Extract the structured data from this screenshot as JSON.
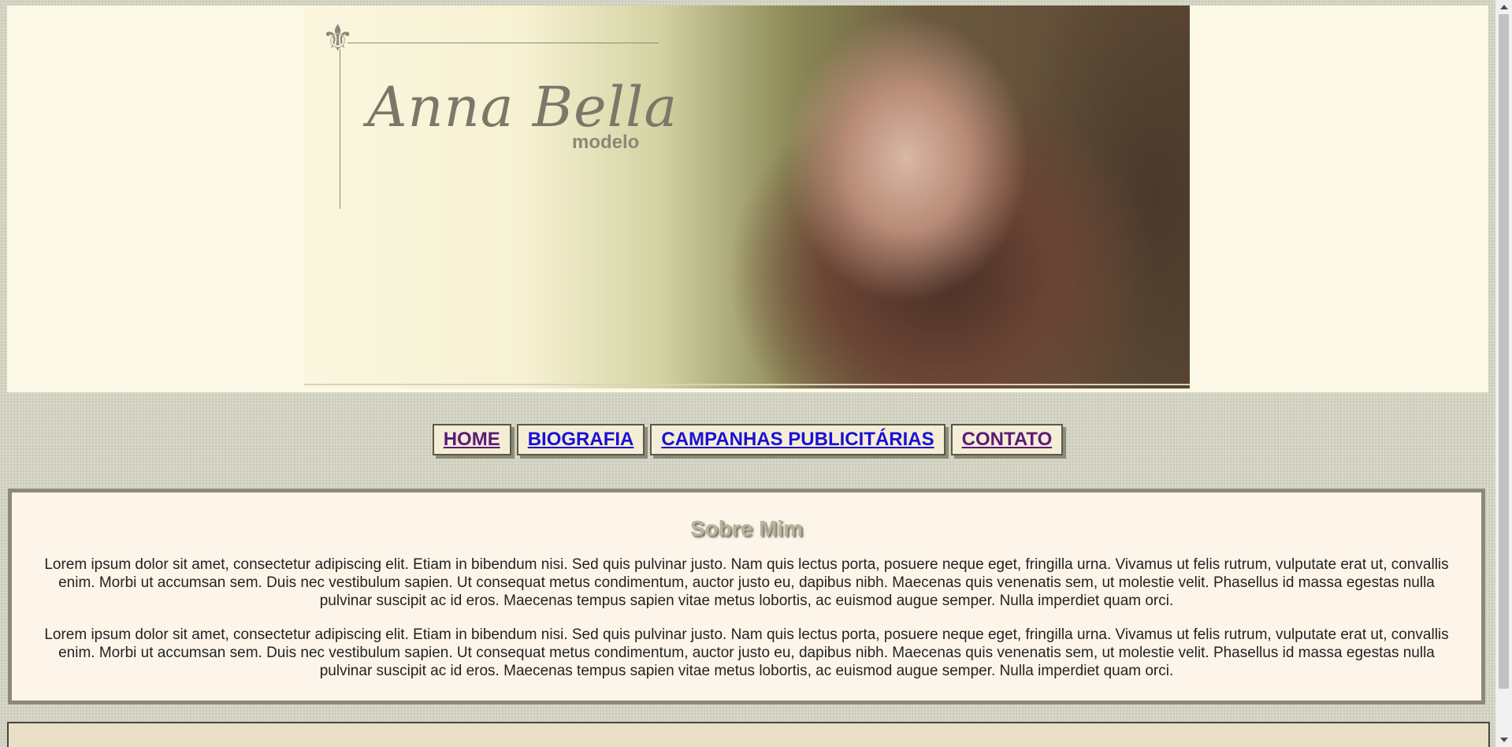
{
  "header": {
    "brand_name": "Anna Bella",
    "brand_subtitle": "modelo",
    "logo_glyph": "⚜"
  },
  "nav": {
    "items": [
      {
        "label": "HOME",
        "visited": true
      },
      {
        "label": "BIOGRAFIA",
        "visited": false
      },
      {
        "label": "CAMPANHAS PUBLICITÁRIAS",
        "visited": false
      },
      {
        "label": "CONTATO",
        "visited": true
      }
    ]
  },
  "content": {
    "title": "Sobre Mim",
    "paragraphs": [
      "Lorem ipsum dolor sit amet, consectetur adipiscing elit. Etiam in bibendum nisi. Sed quis pulvinar justo. Nam quis lectus porta, posuere neque eget, fringilla urna. Vivamus ut felis rutrum, vulputate erat ut, convallis enim. Morbi ut accumsan sem. Duis nec vestibulum sapien. Ut consequat metus condimentum, auctor justo eu, dapibus nibh. Maecenas quis venenatis sem, ut molestie velit. Phasellus id massa egestas nulla pulvinar suscipit ac id eros. Maecenas tempus sapien vitae metus lobortis, ac euismod augue semper. Nulla imperdiet quam orci.",
      "Lorem ipsum dolor sit amet, consectetur adipiscing elit. Etiam in bibendum nisi. Sed quis pulvinar justo. Nam quis lectus porta, posuere neque eget, fringilla urna. Vivamus ut felis rutrum, vulputate erat ut, convallis enim. Morbi ut accumsan sem. Duis nec vestibulum sapien. Ut consequat metus condimentum, auctor justo eu, dapibus nibh. Maecenas quis venenatis sem, ut molestie velit. Phasellus id massa egestas nulla pulvinar suscipit ac id eros. Maecenas tempus sapien vitae metus lobortis, ac euismod augue semper. Nulla imperdiet quam orci."
    ]
  },
  "colors": {
    "link": "#1a10d6",
    "link_visited": "#5c1a78",
    "content_bg": "#fdf5ea",
    "header_bg": "#fcf9e6"
  }
}
